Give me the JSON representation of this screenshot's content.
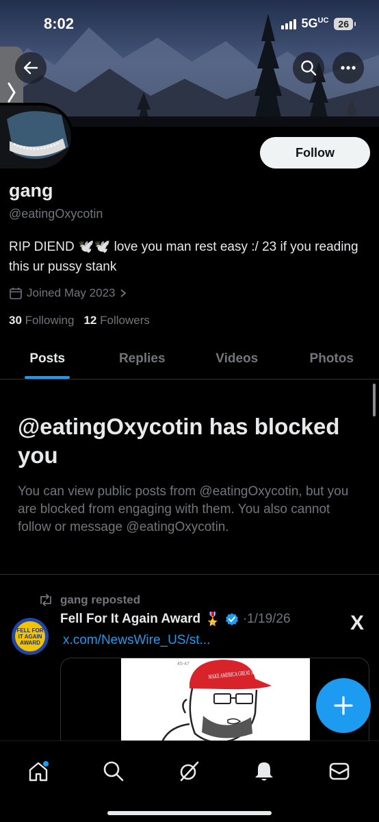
{
  "status_bar": {
    "time": "8:02",
    "network": "5G",
    "network_suffix": "UC",
    "battery": "26"
  },
  "profile": {
    "name": "gang",
    "handle": "@eatingOxycotin",
    "bio": "RIP DIEND 🕊️🕊️ love you man rest easy :/ 23 if you reading this ur pussy stank",
    "joined": "Joined May 2023",
    "following_count": "30",
    "following_label": "Following",
    "followers_count": "12",
    "followers_label": "Followers",
    "follow_button": "Follow"
  },
  "tabs": [
    {
      "label": "Posts",
      "active": true
    },
    {
      "label": "Replies",
      "active": false
    },
    {
      "label": "Videos",
      "active": false
    },
    {
      "label": "Photos",
      "active": false
    }
  ],
  "blocked": {
    "title": "@eatingOxycotin has blocked you",
    "description": "You can view public posts from @eatingOxycotin, but you are blocked from engaging with them. You also cannot follow or message @eatingOxycotin."
  },
  "post": {
    "repost_label": "gang reposted",
    "author_name": "Fell For It Again Award",
    "author_badge": "🎖️",
    "date": "·1/19/26",
    "link": "x.com/NewsWire_US/st...",
    "avatar_text": "FELL FOR IT AGAIN AWARD",
    "x_logo": "X",
    "meme_text": "MAKE AMERICA GREAT AGAIN"
  },
  "icons": {
    "back": "back-arrow-icon",
    "search": "search-icon",
    "more": "more-icon",
    "calendar": "calendar-icon",
    "repost": "repost-icon",
    "verified": "verified-icon",
    "compose": "plus-icon",
    "nav_home": "home-icon",
    "nav_search": "search-icon",
    "nav_grok": "grok-icon",
    "nav_notifications": "bell-icon",
    "nav_messages": "mail-icon"
  },
  "colors": {
    "accent": "#1d9bf0",
    "muted": "#71767b",
    "text": "#e7e9ea",
    "background": "#000000"
  }
}
